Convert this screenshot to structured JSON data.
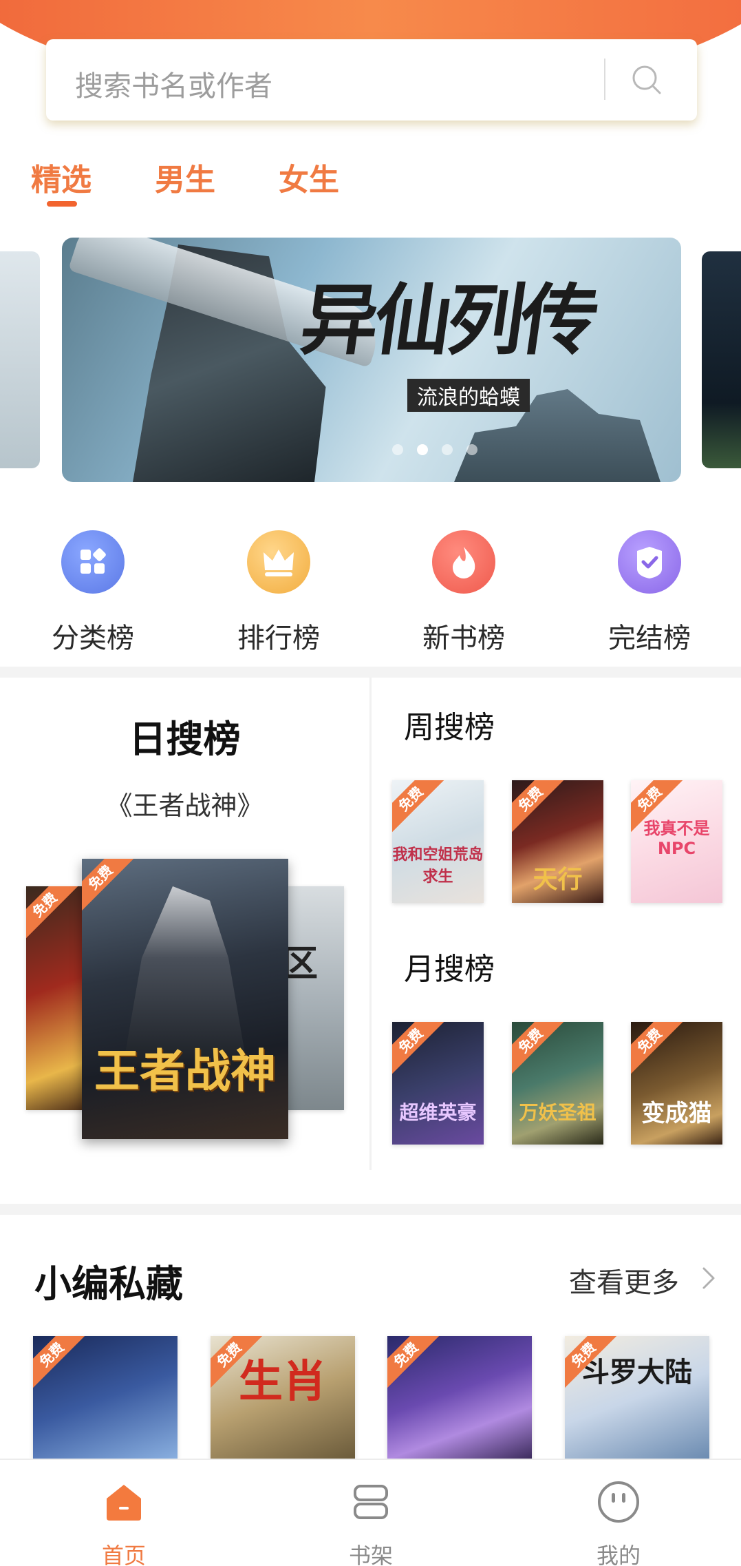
{
  "search": {
    "placeholder": "搜索书名或作者",
    "icon": "search-icon"
  },
  "tabs": [
    {
      "label": "精选",
      "active": true
    },
    {
      "label": "男生"
    },
    {
      "label": "女生"
    }
  ],
  "banner": {
    "title": "异仙列传",
    "subtitle": "流浪的蛤蟆",
    "slides": 4,
    "active_slide": 1
  },
  "categories": [
    {
      "label": "分类榜",
      "icon": "grid-icon",
      "color": "#6b8cf0"
    },
    {
      "label": "排行榜",
      "icon": "crown-icon",
      "color": "#f5b54a"
    },
    {
      "label": "新书榜",
      "icon": "flame-icon",
      "color": "#f36a5d"
    },
    {
      "label": "完结榜",
      "icon": "check-icon",
      "color": "#9c7ef0"
    }
  ],
  "daily": {
    "title": "日搜榜",
    "featured": "《王者战神》",
    "cover_title": "王者战神",
    "badge": "免费"
  },
  "weekly": {
    "title": "周搜榜",
    "covers": [
      "我和空姐荒岛求生",
      "天行",
      "我真不是NPC"
    ]
  },
  "monthly": {
    "title": "月搜榜",
    "covers": [
      "超维英豪",
      "万妖圣祖",
      "变成猫"
    ]
  },
  "picks": {
    "title": "小编私藏",
    "more": "查看更多",
    "covers": [
      "",
      "生肖",
      "",
      "斗罗大陆"
    ]
  },
  "nav": [
    {
      "label": "首页",
      "icon": "home-icon",
      "active": true
    },
    {
      "label": "书架",
      "icon": "bookshelf-icon"
    },
    {
      "label": "我的",
      "icon": "profile-icon"
    }
  ],
  "colors": {
    "accent": "#f07a42",
    "nav_active": "#f07a42",
    "nav_inactive": "#888888"
  }
}
